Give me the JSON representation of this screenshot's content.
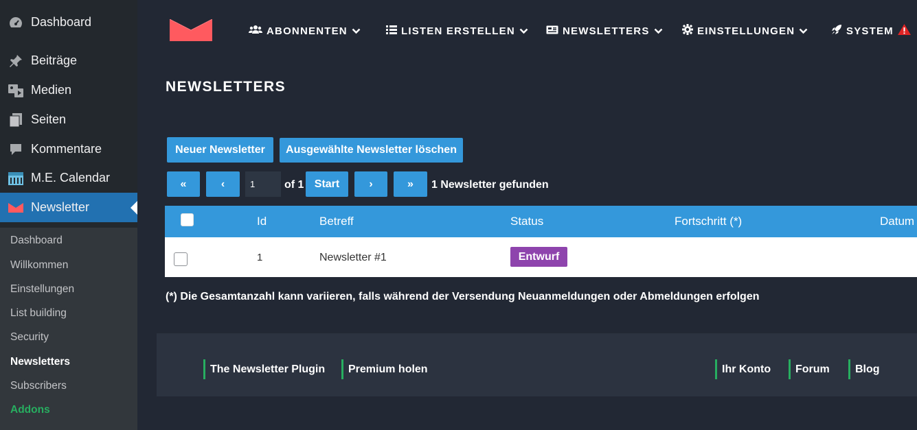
{
  "sidebar": {
    "items": [
      {
        "label": "Dashboard",
        "icon": "dashboard-icon"
      },
      {
        "label": "Beiträge",
        "icon": "pin-icon"
      },
      {
        "label": "Medien",
        "icon": "media-icon"
      },
      {
        "label": "Seiten",
        "icon": "pages-icon"
      },
      {
        "label": "Kommentare",
        "icon": "comment-icon"
      },
      {
        "label": "M.E. Calendar",
        "icon": "calendar-icon"
      },
      {
        "label": "Newsletter",
        "icon": "newsletter-icon"
      }
    ],
    "submenu": [
      "Dashboard",
      "Willkommen",
      "Einstellungen",
      "List building",
      "Security",
      "Newsletters",
      "Subscribers",
      "Addons"
    ]
  },
  "topnav": {
    "items": [
      {
        "label": "ABONNENTEN",
        "icon": "users-icon"
      },
      {
        "label": "LISTEN ERSTELLEN",
        "icon": "list-icon"
      },
      {
        "label": "NEWSLETTERS",
        "icon": "newspaper-icon"
      },
      {
        "label": "EINSTELLUNGEN",
        "icon": "gear-icon"
      },
      {
        "label": "SYSTEM",
        "icon": "rocket-icon"
      }
    ]
  },
  "page": {
    "title": "NEWSLETTERS"
  },
  "actions": {
    "new": "Neuer Newsletter",
    "delete": "Ausgewählte Newsletter löschen"
  },
  "pagination": {
    "first": "«",
    "prev": "‹",
    "page": "1",
    "of": "of 1",
    "start": "Start",
    "next": "›",
    "last": "»",
    "found": "1 Newsletter gefunden"
  },
  "table": {
    "headers": [
      "Id",
      "Betreff",
      "Status",
      "Fortschritt  (*)",
      "Datum"
    ],
    "rows": [
      {
        "id": "1",
        "subject": "Newsletter #1",
        "status": "Entwurf"
      }
    ]
  },
  "footnote": "(*) Die Gesamtanzahl kann variieren, falls während der Versendung Neuanmeldungen oder Abmeldungen erfolgen",
  "footer": {
    "links": [
      "The Newsletter Plugin",
      "Premium holen",
      "Ihr Konto",
      "Forum",
      "Blog"
    ]
  },
  "colors": {
    "accent": "#3498db",
    "badge": "#8e44ad",
    "footer_accent": "#27ae60",
    "logo": "#ff5a5f",
    "warning": "#e02424"
  }
}
